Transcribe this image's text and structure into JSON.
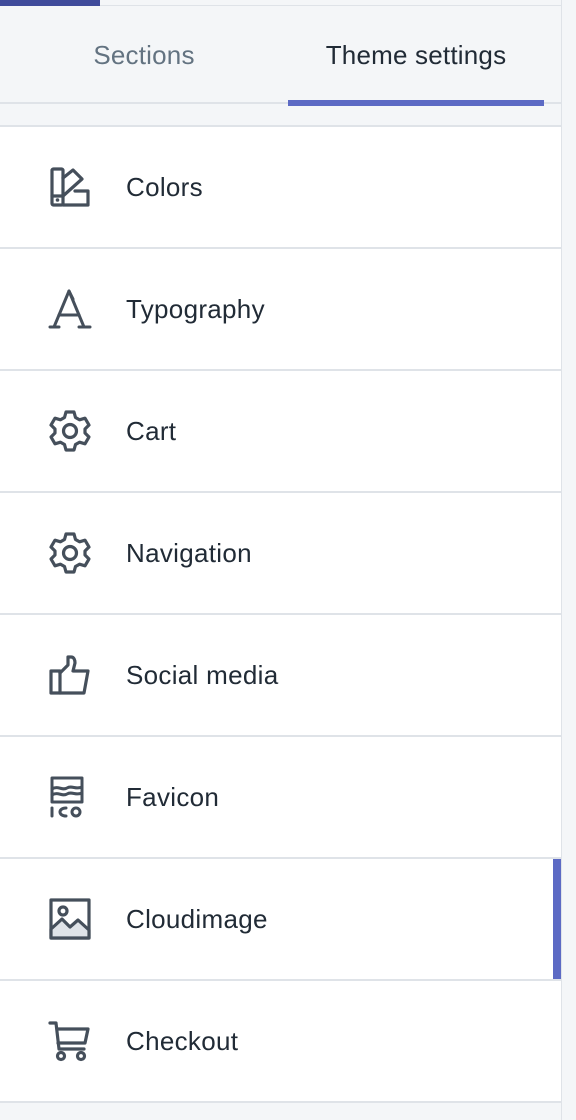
{
  "tabs": [
    {
      "label": "Sections",
      "selected": false
    },
    {
      "label": "Theme settings",
      "selected": true
    }
  ],
  "accent_color": "#5c6ac4",
  "settings": {
    "items": [
      {
        "label": "Colors",
        "icon": "palette-icon"
      },
      {
        "label": "Typography",
        "icon": "typography-icon"
      },
      {
        "label": "Cart",
        "icon": "gear-icon"
      },
      {
        "label": "Navigation",
        "icon": "gear-icon"
      },
      {
        "label": "Social media",
        "icon": "thumbs-up-icon"
      },
      {
        "label": "Favicon",
        "icon": "favicon-icon"
      },
      {
        "label": "Cloudimage",
        "icon": "image-icon",
        "active": true
      },
      {
        "label": "Checkout",
        "icon": "cart-icon"
      }
    ]
  }
}
